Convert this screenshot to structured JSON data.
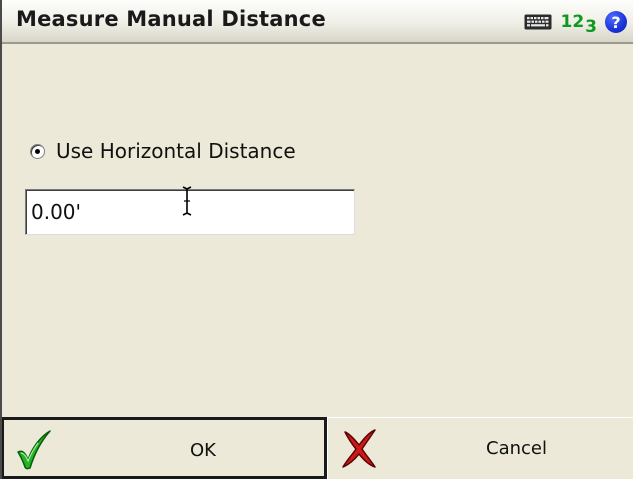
{
  "window": {
    "title": "Measure Manual Distance",
    "status_icons": [
      "keyboard-icon",
      "numeric-input-icon",
      "help-icon"
    ],
    "numeric_indicator": "123",
    "help_glyph": "?"
  },
  "form": {
    "radio": {
      "label": "Use Horizontal Distance",
      "selected": true
    },
    "distance_input": {
      "value": "0.00'"
    }
  },
  "buttons": {
    "ok_label": "OK",
    "cancel_label": "Cancel"
  },
  "colors": {
    "background": "#ece9d8",
    "numeric_indicator": "#0d9b1f",
    "help": "#1a33d8",
    "ok_check": "#22b422",
    "cancel_x": "#d01818"
  }
}
